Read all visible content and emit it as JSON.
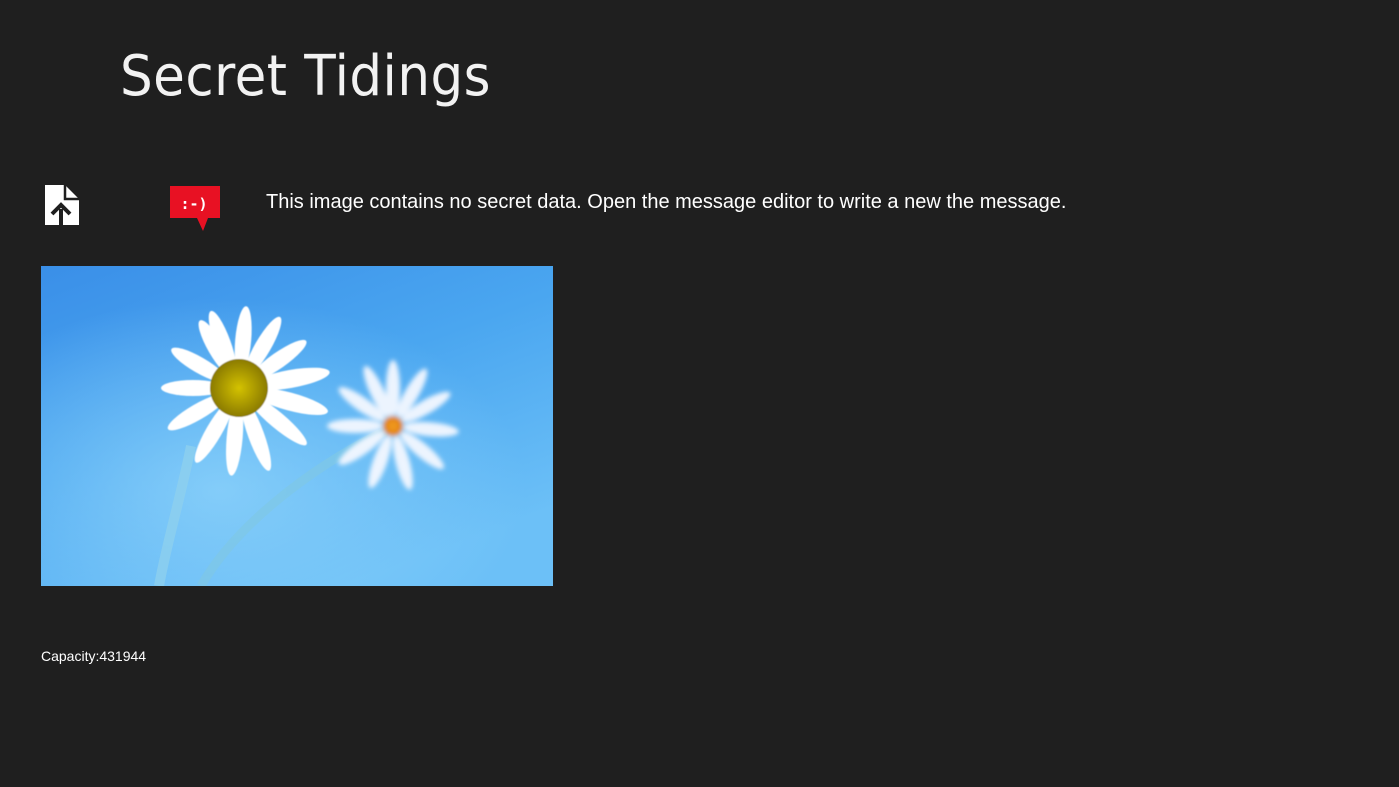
{
  "app": {
    "title": "Secret Tidings"
  },
  "toolbar": {
    "open_file_icon": "open-file-icon",
    "message_editor_icon": "smiley-speech-bubble-icon",
    "message_editor_icon_text": ":-)"
  },
  "status": {
    "message": "This image contains no secret data. Open the message editor to write a new the message."
  },
  "image": {
    "subject": "daisy-flowers-on-blue"
  },
  "info": {
    "capacity_label": "Capacity:",
    "capacity_value": "431944"
  },
  "colors": {
    "background": "#1f1f1f",
    "accent_red": "#e81123",
    "text": "#ffffff"
  }
}
